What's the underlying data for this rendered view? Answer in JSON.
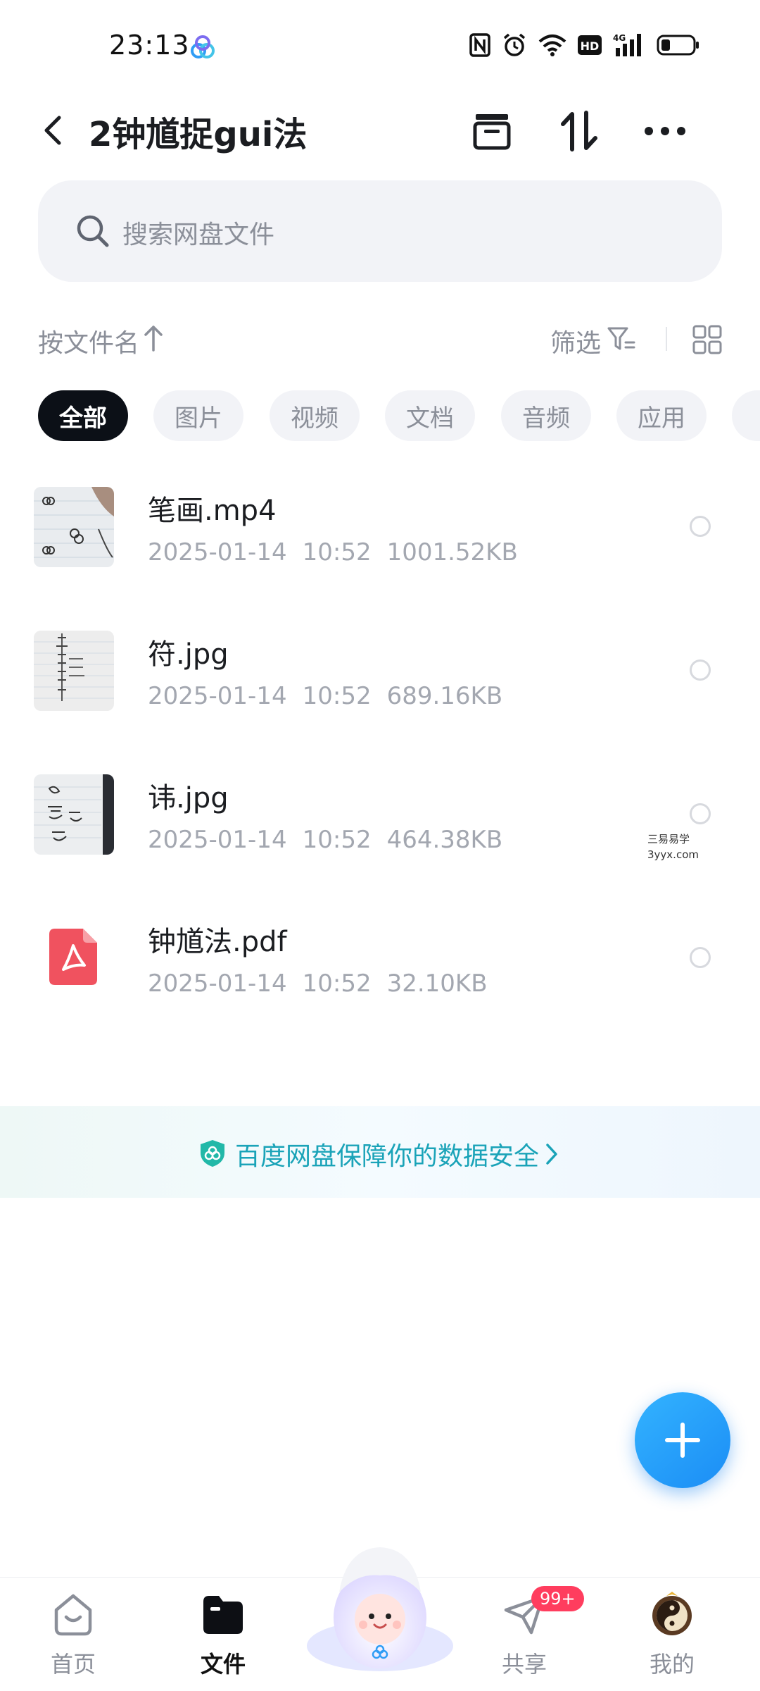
{
  "status_bar": {
    "time": "23:13",
    "network": "4G",
    "hd_label": "HD"
  },
  "header": {
    "title": "2钟馗捉gui法"
  },
  "search": {
    "placeholder": "搜索网盘文件"
  },
  "sort_bar": {
    "sort_label": "按文件名",
    "filter_label": "筛选"
  },
  "categories": [
    {
      "label": "全部",
      "active": true
    },
    {
      "label": "图片",
      "active": false
    },
    {
      "label": "视频",
      "active": false
    },
    {
      "label": "文档",
      "active": false
    },
    {
      "label": "音频",
      "active": false
    },
    {
      "label": "应用",
      "active": false
    }
  ],
  "files": [
    {
      "name": "笔画.mp4",
      "date": "2025-01-14",
      "time": "10:52",
      "size": "1001.52KB",
      "icon": "video-thumbnail"
    },
    {
      "name": "符.jpg",
      "date": "2025-01-14",
      "time": "10:52",
      "size": "689.16KB",
      "icon": "image-thumbnail"
    },
    {
      "name": "讳.jpg",
      "date": "2025-01-14",
      "time": "10:52",
      "size": "464.38KB",
      "icon": "image-thumbnail"
    },
    {
      "name": "钟馗法.pdf",
      "date": "2025-01-14",
      "time": "10:52",
      "size": "32.10KB",
      "icon": "pdf-icon"
    }
  ],
  "watermark": {
    "line1": "三易易学",
    "line2": "3yyx.com"
  },
  "security_banner": {
    "text": "百度网盘保障你的数据安全"
  },
  "bottom_nav": {
    "items": [
      {
        "label": "首页",
        "icon": "home-icon",
        "active": false
      },
      {
        "label": "文件",
        "icon": "folder-icon",
        "active": true
      },
      {
        "label": "共享",
        "icon": "share-plane-icon",
        "active": false,
        "badge": "99+"
      },
      {
        "label": "我的",
        "icon": "profile-avatar-icon",
        "active": false
      }
    ]
  },
  "colors": {
    "accent": "#1b8df5",
    "security_text": "#1aa3b8",
    "active_chip": "#0c1017",
    "badge": "#ff3d5e"
  }
}
